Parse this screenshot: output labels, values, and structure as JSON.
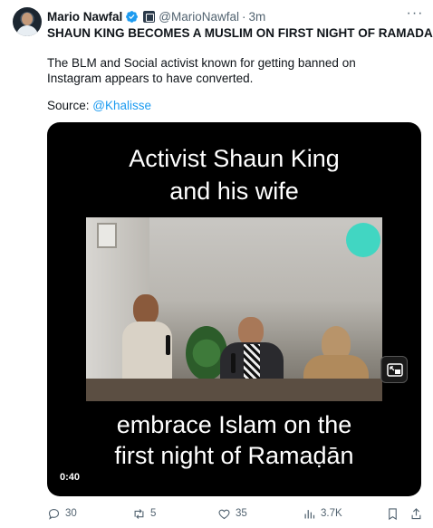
{
  "author": {
    "display_name": "Mario Nawfal",
    "handle": "@MarioNawfal",
    "separator": "·",
    "time": "3m",
    "verified_icon": "verified-badge-icon",
    "affiliate_icon": "affiliate-badge-icon"
  },
  "tweet": {
    "headline": "SHAUN KING BECOMES A MUSLIM ON FIRST NIGHT OF RAMADAN",
    "description": "The BLM and Social activist known for getting banned on Instagram appears to have converted.",
    "source_prefix": "Source: ",
    "source_link": "@Khalisse"
  },
  "video": {
    "caption_top_line1": "Activist Shaun King",
    "caption_top_line2": "and his wife",
    "caption_bottom_line1": "embrace Islam on the",
    "caption_bottom_line2": "first night of Ramaḍān",
    "duration": "0:40"
  },
  "actions": {
    "replies": "30",
    "reposts": "5",
    "likes": "35",
    "views": "3.7K"
  },
  "colors": {
    "accent": "#1d9bf0",
    "muted": "#536471",
    "text": "#0f1419"
  }
}
